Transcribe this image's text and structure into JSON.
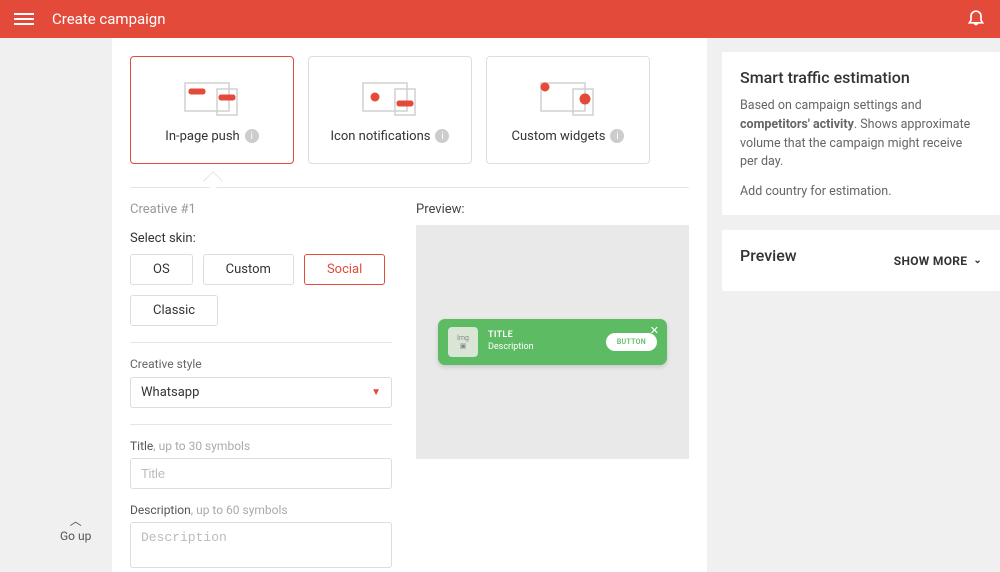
{
  "header": {
    "title": "Create campaign"
  },
  "cards": [
    {
      "label": "In-page push",
      "active": true
    },
    {
      "label": "Icon notifications",
      "active": false
    },
    {
      "label": "Custom widgets",
      "active": false
    }
  ],
  "creative": {
    "heading": "Creative #1",
    "skin_label": "Select skin:",
    "skins": [
      {
        "label": "OS",
        "active": false
      },
      {
        "label": "Custom",
        "active": false
      },
      {
        "label": "Social",
        "active": true
      },
      {
        "label": "Classic",
        "active": false
      }
    ],
    "style_label": "Creative style",
    "style_value": "Whatsapp",
    "title_field": {
      "label": "Title",
      "hint": ", up to 30 symbols",
      "placeholder": "Title",
      "value": ""
    },
    "desc_field": {
      "label": "Description",
      "hint": ", up to 60 symbols",
      "placeholder": "Description",
      "value": ""
    }
  },
  "preview": {
    "label": "Preview:",
    "notif": {
      "img_label": "Img",
      "title": "TITLE",
      "desc": "Description",
      "button": "BUTTON"
    }
  },
  "est_panel": {
    "title": "Smart traffic estimation",
    "body_pre": "Based on campaign settings and ",
    "body_bold": "competitors' activity",
    "body_post": ". Shows approximate volume that the campaign might receive per day.",
    "action": "Add country for estimation."
  },
  "preview_panel": {
    "title": "Preview",
    "show_more": "SHOW MORE"
  },
  "go_up": "Go up"
}
